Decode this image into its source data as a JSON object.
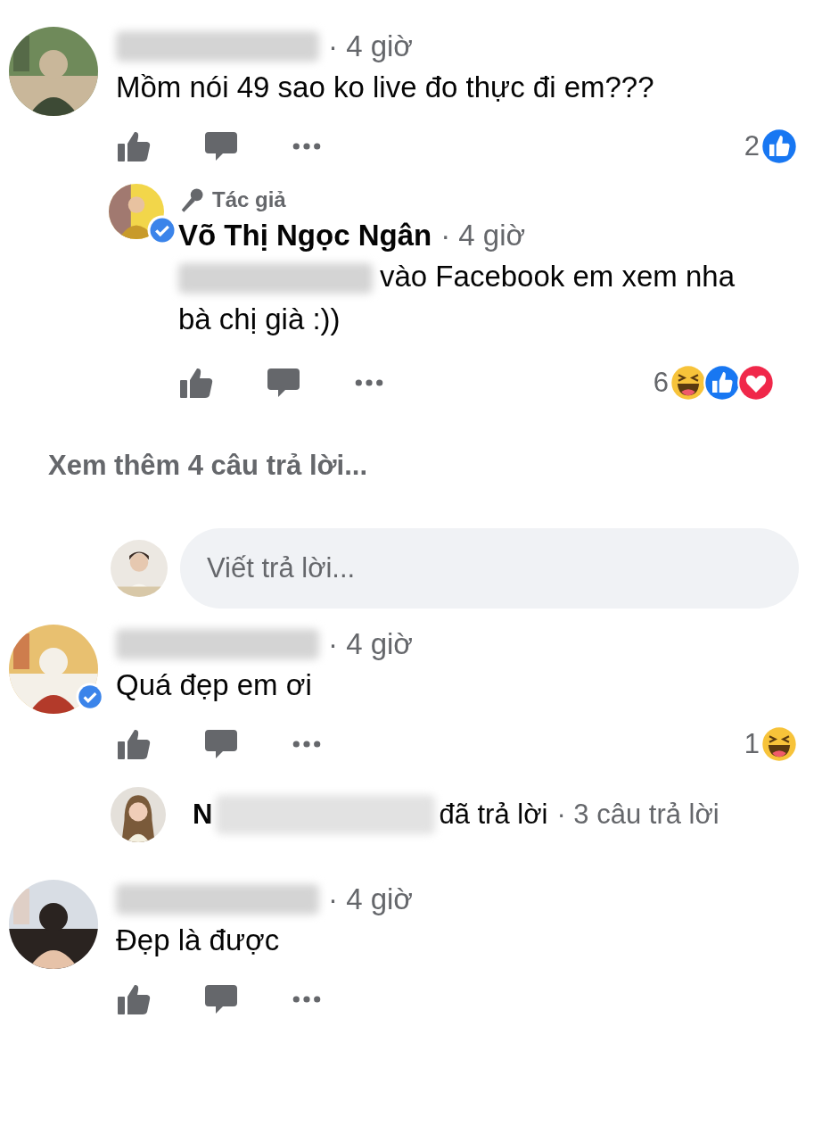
{
  "comments": [
    {
      "name_blurred": true,
      "time": "· 4 giờ",
      "text": "Mồm nói 49 sao ko live đo thực đi em???",
      "verified": false,
      "reaction_count": "2",
      "reactions": [
        {
          "kind": "like"
        }
      ],
      "replies": [
        {
          "badge": "Tác giả",
          "name": "Võ Thị Ngọc Ngân",
          "verified": true,
          "time": "· 4 giờ",
          "mention_blurred": true,
          "text": "vào Facebook em xem nha bà chị già :))",
          "reaction_count": "6",
          "reactions": [
            {
              "kind": "haha"
            },
            {
              "kind": "like"
            },
            {
              "kind": "love"
            }
          ]
        }
      ],
      "more_replies": "Xem thêm 4 câu trả lời...",
      "reply_placeholder": "Viết trả lời..."
    },
    {
      "name_blurred": true,
      "time": "· 4 giờ",
      "text": "Quá đẹp em ơi",
      "verified": true,
      "reaction_count": "1",
      "reactions": [
        {
          "kind": "haha"
        }
      ],
      "reply_summary": {
        "name_start": "N",
        "action": "đã trả lời",
        "count": "· 3 câu trả lời"
      }
    },
    {
      "name_blurred": true,
      "time": "· 4 giờ",
      "text": "Đẹp là được",
      "verified": false
    }
  ]
}
